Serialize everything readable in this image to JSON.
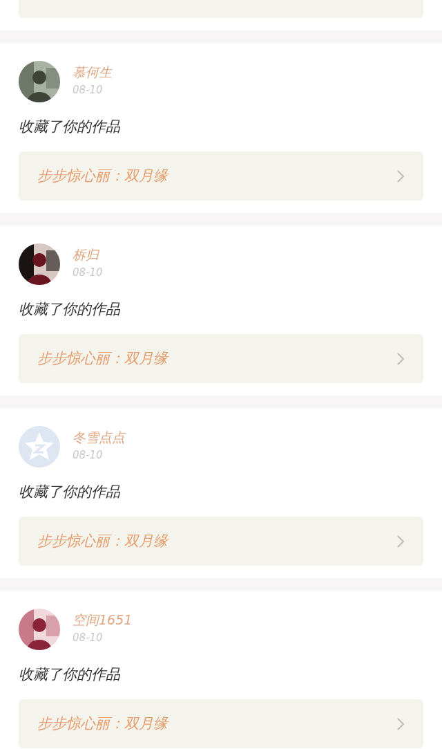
{
  "notifications": [
    {
      "name": "慕何生",
      "date": "08-10",
      "action": "收藏了你的作品",
      "work": "步步惊心丽：双月缘"
    },
    {
      "name": "柝归",
      "date": "08-10",
      "action": "收藏了你的作品",
      "work": "步步惊心丽：双月缘"
    },
    {
      "avatar": {
        "kind": "star"
      },
      "name": "冬雪点点",
      "date": "08-10",
      "action": "收藏了你的作品",
      "work": "步步惊心丽：双月缘"
    },
    {
      "name": "空间1651",
      "date": "08-10",
      "action": "收藏了你的作品",
      "work": "步步惊心丽：双月缘"
    }
  ]
}
